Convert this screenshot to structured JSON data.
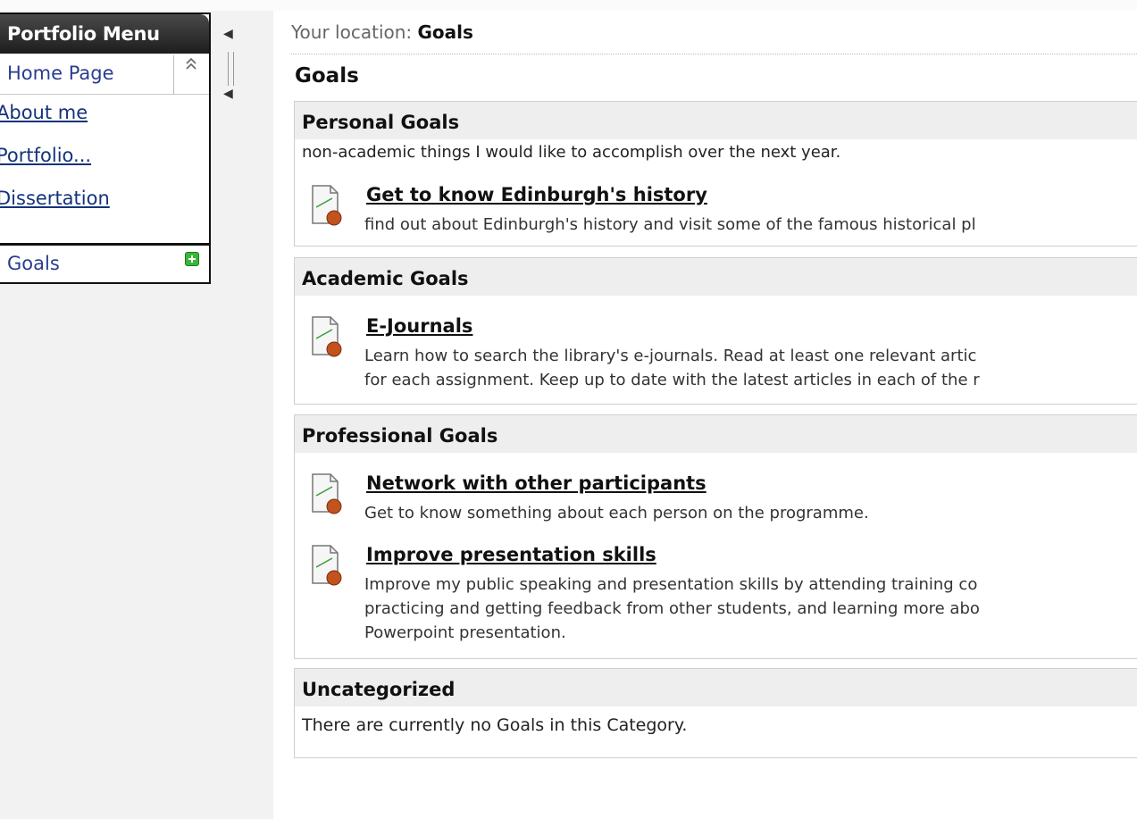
{
  "menu": {
    "title": "Portfolio Menu",
    "home": "Home Page",
    "items": [
      "About me",
      "Portfolio...",
      "Dissertation"
    ],
    "goals_item": "Goals"
  },
  "breadcrumb": {
    "prefix": "Your location: ",
    "current": "Goals"
  },
  "page_title": "Goals",
  "categories": [
    {
      "name": "Personal Goals",
      "description": "non-academic things I would like to accomplish over the next year.",
      "goals": [
        {
          "title": "Get to know Edinburgh's history",
          "text_lines": [
            "find out about Edinburgh's history and visit some of the famous historical pl"
          ]
        }
      ]
    },
    {
      "name": "Academic Goals",
      "goals": [
        {
          "title": "E-Journals",
          "text_lines": [
            "Learn how to search the library's e-journals. Read at least one relevant artic",
            "for each assignment. Keep up to date with the latest articles in each of the r"
          ]
        }
      ]
    },
    {
      "name": "Professional Goals",
      "goals": [
        {
          "title": "Network with other participants",
          "text_lines": [
            "Get to know something about each person on the programme."
          ]
        },
        {
          "title": "Improve presentation skills",
          "text_lines": [
            "Improve my public speaking and presentation skills by attending training co",
            "practicing and getting feedback from other students, and learning more abo",
            "Powerpoint presentation."
          ]
        }
      ]
    },
    {
      "name": "Uncategorized",
      "empty_message": "There are currently no Goals in this Category."
    }
  ],
  "icons": {
    "goal": "goal-document-icon",
    "collapse": "double-chevron-up-icon",
    "add": "plus-icon",
    "splitter": "arrow-left-icon"
  },
  "colors": {
    "menu_header": "#1d1d1d",
    "link": "#14337a",
    "category_header_bg": "#eeeeee",
    "add_icon": "#3bb53b"
  }
}
